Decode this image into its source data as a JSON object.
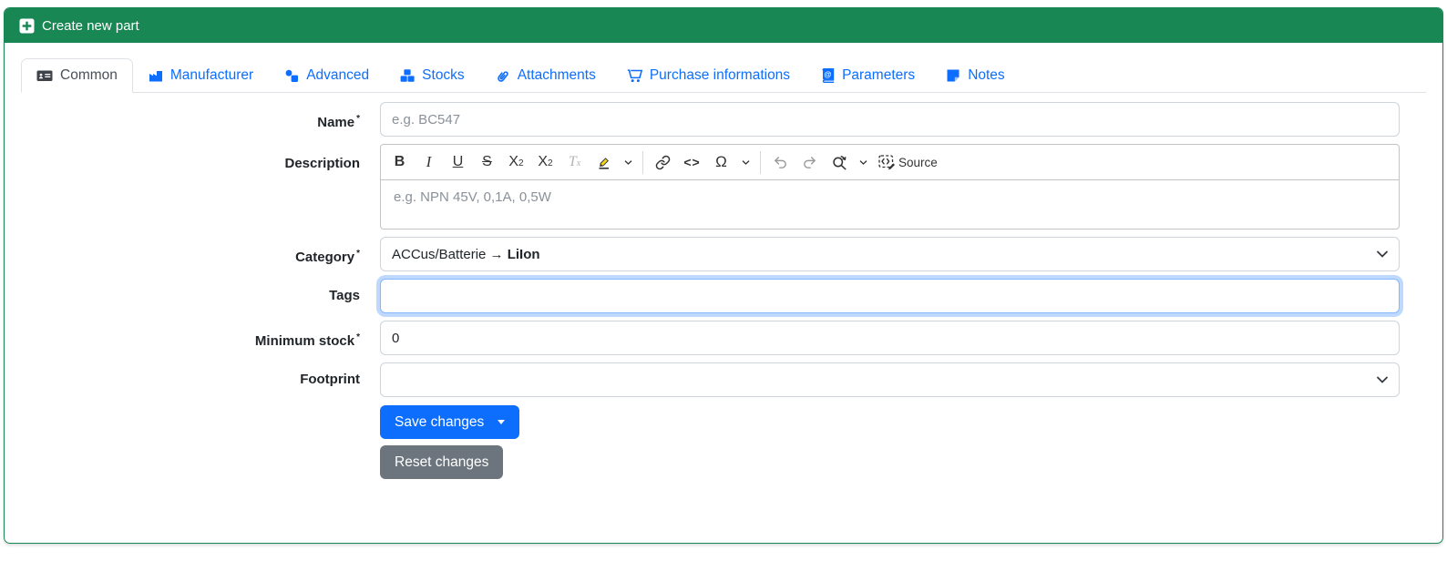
{
  "header": {
    "title": "Create new part"
  },
  "tabs": [
    {
      "label": "Common",
      "active": true
    },
    {
      "label": "Manufacturer"
    },
    {
      "label": "Advanced"
    },
    {
      "label": "Stocks"
    },
    {
      "label": "Attachments"
    },
    {
      "label": "Purchase informations"
    },
    {
      "label": "Parameters"
    },
    {
      "label": "Notes"
    }
  ],
  "form": {
    "name": {
      "label": "Name",
      "required": "*",
      "placeholder": "e.g. BC547"
    },
    "description": {
      "label": "Description",
      "placeholder": "e.g. NPN 45V, 0,1A, 0,5W",
      "toolbar": {
        "bold": "B",
        "italic": "I",
        "underline": "U",
        "strikethrough": "S",
        "subscript_base": "X",
        "subscript_mark": "2",
        "superscript_base": "X",
        "superscript_mark": "2",
        "remove_format_base": "T",
        "remove_format_mark": "x",
        "code": "<>",
        "special_characters": "Ω",
        "source_label": "Source"
      }
    },
    "category": {
      "label": "Category",
      "required": "*",
      "value_path": "ACCus/Batterie → ",
      "value_selected": "LiIon"
    },
    "tags": {
      "label": "Tags",
      "value": ""
    },
    "minimum_stock": {
      "label": "Minimum stock",
      "required": "*",
      "value": "0"
    },
    "footprint": {
      "label": "Footprint",
      "value": ""
    }
  },
  "buttons": {
    "save": "Save changes",
    "reset": "Reset changes"
  },
  "colors": {
    "success": "#198754",
    "primary": "#0d6efd",
    "secondary": "#6c757d",
    "focus_ring": "#86b7fe",
    "highlight_yellow": "#f6d31c"
  }
}
